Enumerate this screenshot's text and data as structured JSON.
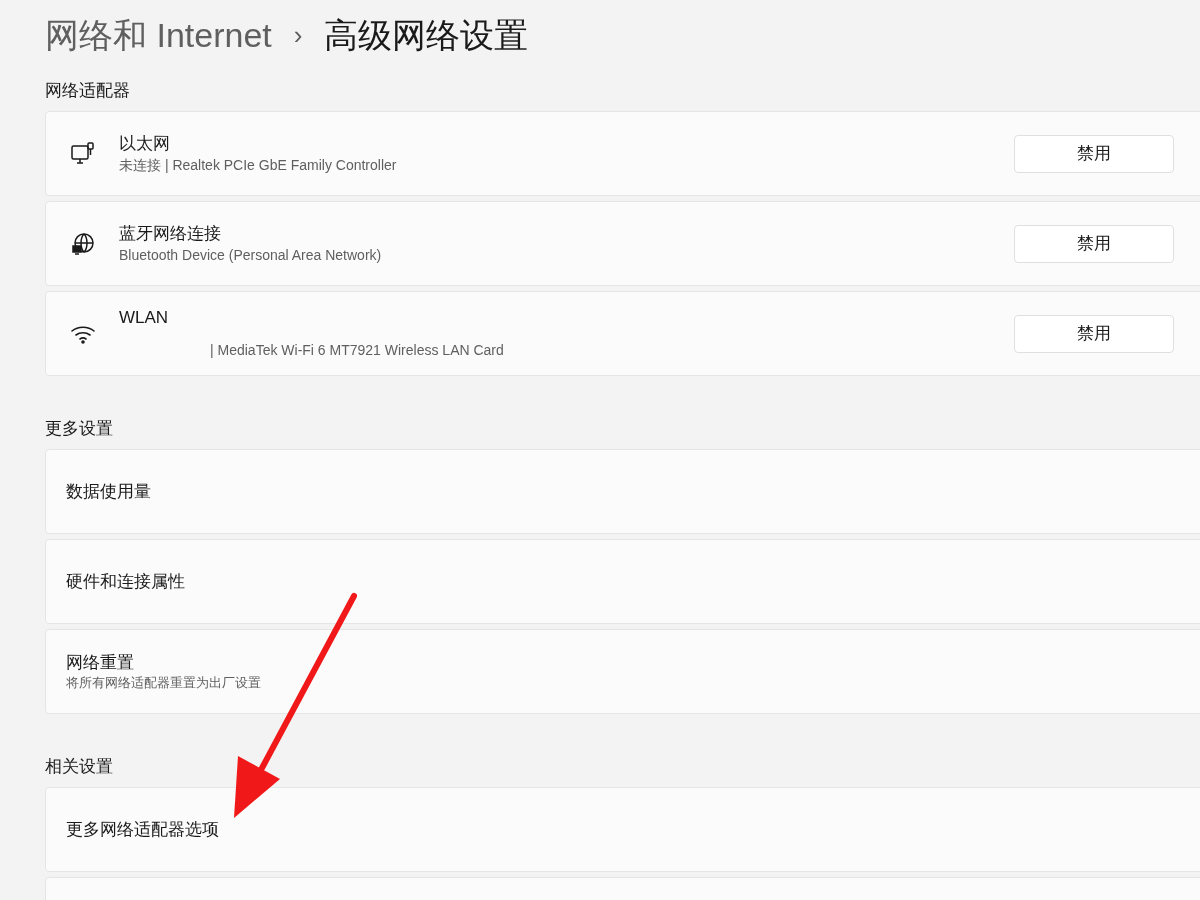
{
  "breadcrumb": {
    "parent": "网络和 Internet",
    "separator": "›",
    "current": "高级网络设置"
  },
  "sections": [
    {
      "title": "网络适配器",
      "items": [
        {
          "kind": "adapter",
          "title": "以太网",
          "subtitle": "未连接 | Realtek PCIe GbE Family Controller",
          "button": "禁用"
        },
        {
          "kind": "adapter",
          "title": "蓝牙网络连接",
          "subtitle": "Bluetooth Device (Personal Area Network)",
          "button": "禁用"
        },
        {
          "kind": "adapter",
          "title": "WLAN",
          "subtitle": "| MediaTek Wi-Fi 6 MT7921 Wireless LAN Card",
          "button": "禁用",
          "subtitle_offset": true
        }
      ]
    },
    {
      "title": "更多设置",
      "items": [
        {
          "kind": "link",
          "title": "数据使用量"
        },
        {
          "kind": "link",
          "title": "硬件和连接属性"
        },
        {
          "kind": "link",
          "title": "网络重置",
          "subtitle": "将所有网络适配器重置为出厂设置"
        }
      ]
    },
    {
      "title": "相关设置",
      "items": [
        {
          "kind": "link",
          "title": "更多网络适配器选项"
        },
        {
          "kind": "partial"
        }
      ]
    }
  ],
  "annotation": {
    "kind": "arrow"
  }
}
